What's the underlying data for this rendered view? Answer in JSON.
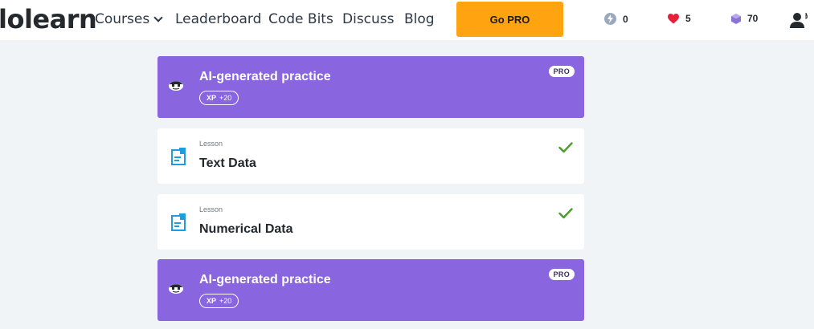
{
  "nav": {
    "logo": "lolearn",
    "links": {
      "courses": "Courses",
      "leaderboard": "Leaderboard",
      "code_bits": "Code Bits",
      "discuss": "Discuss",
      "blog": "Blog"
    },
    "go_pro": "Go PRO",
    "stats": {
      "bolts": "0",
      "hearts": "5",
      "gems": "70"
    }
  },
  "cards": [
    {
      "type": "ai",
      "title": "AI-generated practice",
      "xp_label": "XP",
      "xp_value": "+20",
      "badge": "PRO"
    },
    {
      "type": "lesson",
      "kind": "Lesson",
      "title": "Text Data"
    },
    {
      "type": "lesson",
      "kind": "Lesson",
      "title": "Numerical Data"
    },
    {
      "type": "ai",
      "title": "AI-generated practice",
      "xp_label": "XP",
      "xp_value": "+20",
      "badge": "PRO"
    }
  ],
  "colors": {
    "accent_purple": "#8965e0",
    "go_pro_orange": "#ffa310",
    "check_green": "#4a9c2d",
    "doc_blue": "#1e9cdf",
    "heart_red": "#e8203a",
    "gem_purple": "#8a73d8"
  }
}
